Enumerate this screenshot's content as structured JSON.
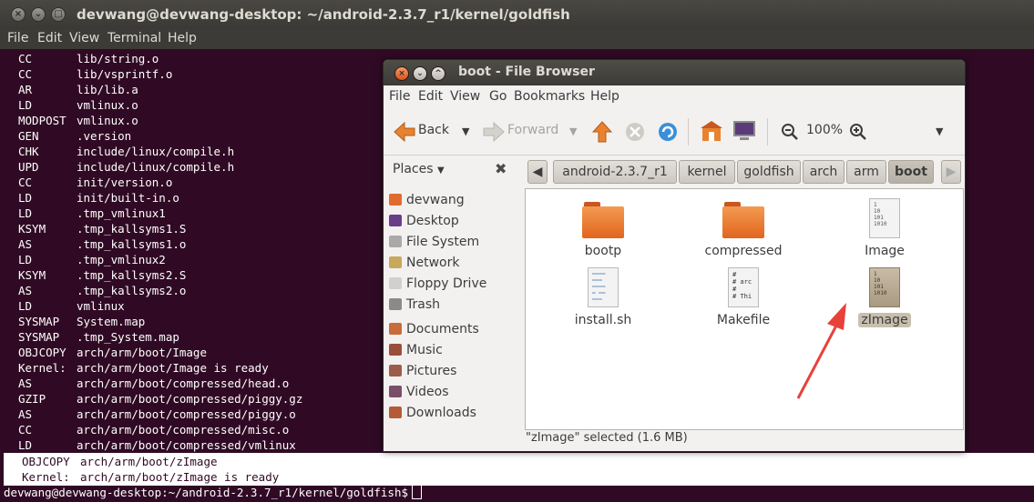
{
  "terminal": {
    "title": "devwang@devwang-desktop: ~/android-2.3.7_r1/kernel/goldfish",
    "menu": [
      "File",
      "Edit",
      "View",
      "Terminal",
      "Help"
    ],
    "lines": [
      [
        "CC",
        "lib/string.o"
      ],
      [
        "CC",
        "lib/vsprintf.o"
      ],
      [
        "AR",
        "lib/lib.a"
      ],
      [
        "LD",
        "vmlinux.o"
      ],
      [
        "MODPOST",
        "vmlinux.o"
      ],
      [
        "GEN",
        ".version"
      ],
      [
        "CHK",
        "include/linux/compile.h"
      ],
      [
        "UPD",
        "include/linux/compile.h"
      ],
      [
        "CC",
        "init/version.o"
      ],
      [
        "LD",
        "init/built-in.o"
      ],
      [
        "LD",
        ".tmp_vmlinux1"
      ],
      [
        "KSYM",
        ".tmp_kallsyms1.S"
      ],
      [
        "AS",
        ".tmp_kallsyms1.o"
      ],
      [
        "LD",
        ".tmp_vmlinux2"
      ],
      [
        "KSYM",
        ".tmp_kallsyms2.S"
      ],
      [
        "AS",
        ".tmp_kallsyms2.o"
      ],
      [
        "LD",
        "vmlinux"
      ],
      [
        "SYSMAP",
        "System.map"
      ],
      [
        "SYSMAP",
        ".tmp_System.map"
      ],
      [
        "OBJCOPY",
        "arch/arm/boot/Image"
      ],
      [
        "Kernel:",
        "arch/arm/boot/Image is ready"
      ],
      [
        "AS",
        "arch/arm/boot/compressed/head.o"
      ],
      [
        "GZIP",
        "arch/arm/boot/compressed/piggy.gz"
      ],
      [
        "AS",
        "arch/arm/boot/compressed/piggy.o"
      ],
      [
        "CC",
        "arch/arm/boot/compressed/misc.o"
      ],
      [
        "LD",
        "arch/arm/boot/compressed/vmlinux"
      ]
    ],
    "highlight_lines": [
      [
        "OBJCOPY",
        "arch/arm/boot/zImage"
      ],
      [
        "Kernel:",
        "arch/arm/boot/zImage is ready"
      ]
    ],
    "prompt": "devwang@devwang-desktop:~/android-2.3.7_r1/kernel/goldfish$"
  },
  "filebrowser": {
    "title": "boot - File Browser",
    "menu": [
      "File",
      "Edit",
      "View",
      "Go",
      "Bookmarks",
      "Help"
    ],
    "toolbar": {
      "back": "Back",
      "forward": "Forward",
      "zoom": "100%"
    },
    "places_label": "Places",
    "breadcrumbs": [
      "android-2.3.7_r1",
      "kernel",
      "goldfish",
      "arch",
      "arm",
      "boot"
    ],
    "sidebar": [
      {
        "label": "devwang",
        "icon": "home-icon",
        "color": "#e06b2e"
      },
      {
        "label": "Desktop",
        "icon": "desktop-icon",
        "color": "#6a3d88"
      },
      {
        "label": "File System",
        "icon": "harddisk-icon",
        "color": "#a9a9a9"
      },
      {
        "label": "Network",
        "icon": "network-icon",
        "color": "#c8a85a"
      },
      {
        "label": "Floppy Drive",
        "icon": "floppy-icon",
        "color": "#d0d0d0"
      },
      {
        "label": "Trash",
        "icon": "trash-icon",
        "color": "#8a8a8a"
      },
      {
        "label": "Documents",
        "icon": "folder-documents-icon",
        "color": "#c96b3a"
      },
      {
        "label": "Music",
        "icon": "folder-music-icon",
        "color": "#9b4d3a"
      },
      {
        "label": "Pictures",
        "icon": "folder-pictures-icon",
        "color": "#9b5d4a"
      },
      {
        "label": "Videos",
        "icon": "folder-videos-icon",
        "color": "#7a4d6a"
      },
      {
        "label": "Downloads",
        "icon": "folder-downloads-icon",
        "color": "#b65a36"
      }
    ],
    "files": [
      {
        "name": "bootp",
        "type": "folder"
      },
      {
        "name": "compressed",
        "type": "folder"
      },
      {
        "name": "Image",
        "type": "binary"
      },
      {
        "name": "install.sh",
        "type": "script"
      },
      {
        "name": "Makefile",
        "type": "makefile"
      },
      {
        "name": "zImage",
        "type": "binary",
        "selected": true
      }
    ],
    "status": "\"zImage\" selected (1.6 MB)",
    "annotation_color": "#e8413a"
  }
}
